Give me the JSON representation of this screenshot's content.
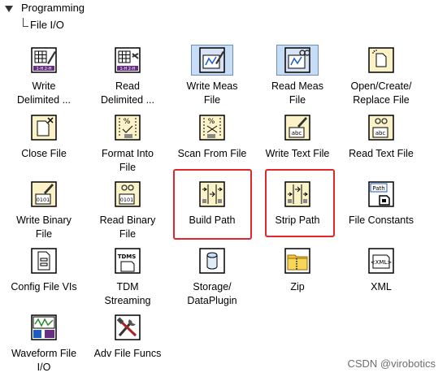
{
  "breadcrumb": {
    "root": "Programming",
    "sub": "File I/O"
  },
  "items": [
    {
      "label": "Write\nDelimited ...",
      "icon": "spreadsheet-write-icon"
    },
    {
      "label": "Read\nDelimited ...",
      "icon": "spreadsheet-read-icon"
    },
    {
      "label": "Write Meas\nFile",
      "icon": "write-meas-file-icon"
    },
    {
      "label": "Read Meas\nFile",
      "icon": "read-meas-file-icon"
    },
    {
      "label": "Open/Create/\nReplace File",
      "icon": "open-file-icon"
    },
    {
      "label": "Close File",
      "icon": "close-file-icon"
    },
    {
      "label": "Format Into\nFile",
      "icon": "format-into-file-icon"
    },
    {
      "label": "Scan From File",
      "icon": "scan-from-file-icon"
    },
    {
      "label": "Write Text File",
      "icon": "write-text-file-icon"
    },
    {
      "label": "Read Text File",
      "icon": "read-text-file-icon"
    },
    {
      "label": "Write Binary\nFile",
      "icon": "write-binary-file-icon"
    },
    {
      "label": "Read Binary\nFile",
      "icon": "read-binary-file-icon"
    },
    {
      "label": "Build Path",
      "icon": "build-path-icon"
    },
    {
      "label": "Strip Path",
      "icon": "strip-path-icon"
    },
    {
      "label": "File Constants",
      "icon": "file-constants-icon"
    },
    {
      "label": "Config File VIs",
      "icon": "config-file-icon"
    },
    {
      "label": "TDM\nStreaming",
      "icon": "tdms-icon"
    },
    {
      "label": "Storage/\nDataPlugin",
      "icon": "storage-icon"
    },
    {
      "label": "Zip",
      "icon": "zip-icon"
    },
    {
      "label": "XML",
      "icon": "xml-icon"
    },
    {
      "label": "Waveform File\nI/O",
      "icon": "waveform-file-icon"
    },
    {
      "label": "Adv File Funcs",
      "icon": "adv-file-funcs-icon"
    }
  ],
  "icon_text": {
    "tdms": "TDMS",
    "xml": "<XML>",
    "path": "Path",
    "abc": "abc",
    "binary": "0101",
    "percent": "%",
    "fmt": "%s",
    "grid_label": "1-H 2-H"
  },
  "highlighted": [
    "Build Path",
    "Strip Path"
  ],
  "colors": {
    "highlight": "#e0272b",
    "icon_fill": "#fbf3c7",
    "selected_bg": "#c7dcf5"
  },
  "watermark": "CSDN @virobotics"
}
